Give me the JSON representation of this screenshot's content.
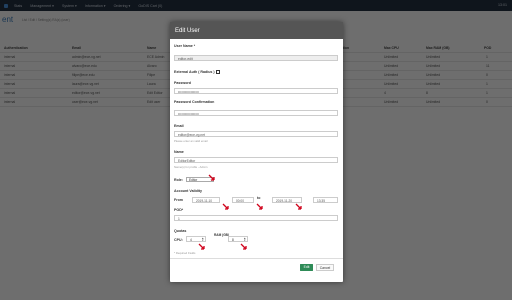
{
  "topbar": {
    "nav": [
      "Stats",
      "Management ▾",
      "System ▾",
      "Information ▾",
      "Ordering ▾",
      "GoDIS Cart (0)"
    ],
    "clock": "13:01"
  },
  "page": {
    "title": "ent",
    "subtitle": "List / Edit / Setting(s) RA(s) (user)"
  },
  "table": {
    "headers": [
      "Authentication",
      "Email",
      "Name",
      "Distribution",
      "Max CPU",
      "Max RAM (GB)",
      "POD"
    ],
    "rows": [
      [
        "internal",
        "admin@ece-vg.net",
        "ECE Admin",
        "",
        "Unlimited",
        "Unlimited",
        "1"
      ],
      [
        "internal",
        "alvaro@ece.edu",
        "Alvaro",
        "",
        "Unlimited",
        "Unlimited",
        "11"
      ],
      [
        "internal",
        "filipe@ece.edu",
        "Filipe",
        "",
        "Unlimited",
        "Unlimited",
        "0"
      ],
      [
        "internal",
        "laura@ece-vg.net",
        "Laura",
        "",
        "Unlimited",
        "Unlimited",
        "1"
      ],
      [
        "internal",
        "editor@ece-vg.net",
        "Edit Editor",
        "",
        "4",
        "8",
        "1"
      ],
      [
        "internal",
        "user@ece-vg.net",
        "Edit user",
        "",
        "Unlimited",
        "Unlimited",
        "0"
      ]
    ]
  },
  "modal": {
    "title": "Edit User",
    "username_label": "User Name *",
    "username_value": "editor-edit",
    "external_auth_label": "External Auth ( Radius )",
    "password_label": "Password",
    "password_value": "••••••••••••••••••",
    "password_confirm_label": "Password Confirmation",
    "password_confirm_value": "••••••••••••••••••",
    "email_label": "Email",
    "email_value": "editor@ece-vg.net",
    "email_help": "Please enter an valid email",
    "name_label": "Name",
    "name_value": "EditorEditor",
    "name_help": "Name(s) for profile - Admin",
    "role_label": "Role:",
    "role_value": "Editor",
    "account_validity_label": "Account Validity",
    "from_label": "From",
    "from_date": "2019-11-10",
    "from_time": "00:00",
    "to_label": "to",
    "to_date": "2019-11-20",
    "to_time": "13:35",
    "pod_label": "POD*",
    "pod_value": "1",
    "quotas_label": "Quotas",
    "cpu_label": "CPU:",
    "cpu_value": "4",
    "ram_label": "RAM (GB)",
    "ram_value": "8",
    "required_note": "* Required Fields",
    "edit_button": "Edit",
    "cancel_button": "Cancel"
  },
  "colors": {
    "topbar": "#232f3e",
    "modal_header": "#555555",
    "edit_button": "#2e8b57",
    "marker": "#d0021b"
  }
}
